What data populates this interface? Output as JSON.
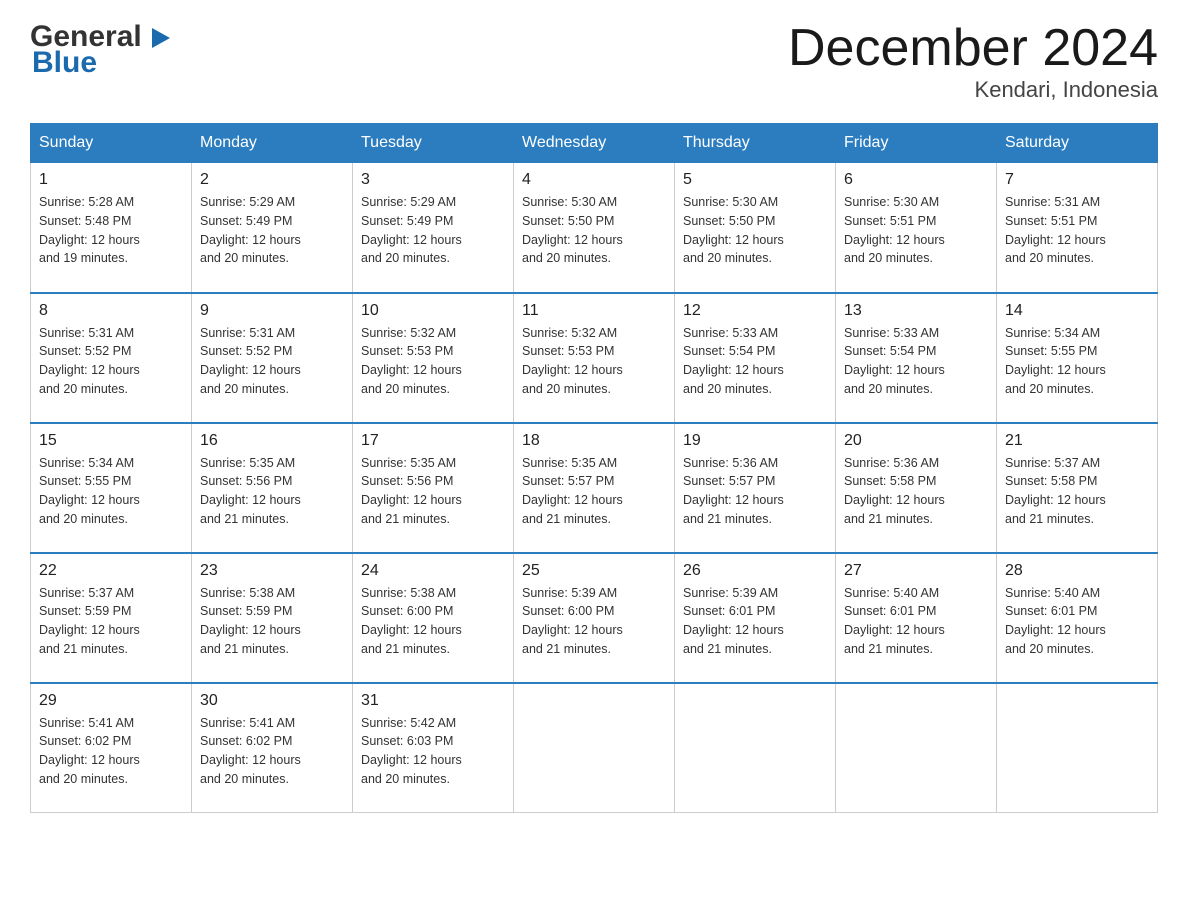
{
  "header": {
    "logo_general": "General",
    "logo_blue": "Blue",
    "month_title": "December 2024",
    "location": "Kendari, Indonesia"
  },
  "days_of_week": [
    "Sunday",
    "Monday",
    "Tuesday",
    "Wednesday",
    "Thursday",
    "Friday",
    "Saturday"
  ],
  "weeks": [
    [
      {
        "day": "1",
        "sunrise": "5:28 AM",
        "sunset": "5:48 PM",
        "daylight": "12 hours and 19 minutes."
      },
      {
        "day": "2",
        "sunrise": "5:29 AM",
        "sunset": "5:49 PM",
        "daylight": "12 hours and 20 minutes."
      },
      {
        "day": "3",
        "sunrise": "5:29 AM",
        "sunset": "5:49 PM",
        "daylight": "12 hours and 20 minutes."
      },
      {
        "day": "4",
        "sunrise": "5:30 AM",
        "sunset": "5:50 PM",
        "daylight": "12 hours and 20 minutes."
      },
      {
        "day": "5",
        "sunrise": "5:30 AM",
        "sunset": "5:50 PM",
        "daylight": "12 hours and 20 minutes."
      },
      {
        "day": "6",
        "sunrise": "5:30 AM",
        "sunset": "5:51 PM",
        "daylight": "12 hours and 20 minutes."
      },
      {
        "day": "7",
        "sunrise": "5:31 AM",
        "sunset": "5:51 PM",
        "daylight": "12 hours and 20 minutes."
      }
    ],
    [
      {
        "day": "8",
        "sunrise": "5:31 AM",
        "sunset": "5:52 PM",
        "daylight": "12 hours and 20 minutes."
      },
      {
        "day": "9",
        "sunrise": "5:31 AM",
        "sunset": "5:52 PM",
        "daylight": "12 hours and 20 minutes."
      },
      {
        "day": "10",
        "sunrise": "5:32 AM",
        "sunset": "5:53 PM",
        "daylight": "12 hours and 20 minutes."
      },
      {
        "day": "11",
        "sunrise": "5:32 AM",
        "sunset": "5:53 PM",
        "daylight": "12 hours and 20 minutes."
      },
      {
        "day": "12",
        "sunrise": "5:33 AM",
        "sunset": "5:54 PM",
        "daylight": "12 hours and 20 minutes."
      },
      {
        "day": "13",
        "sunrise": "5:33 AM",
        "sunset": "5:54 PM",
        "daylight": "12 hours and 20 minutes."
      },
      {
        "day": "14",
        "sunrise": "5:34 AM",
        "sunset": "5:55 PM",
        "daylight": "12 hours and 20 minutes."
      }
    ],
    [
      {
        "day": "15",
        "sunrise": "5:34 AM",
        "sunset": "5:55 PM",
        "daylight": "12 hours and 20 minutes."
      },
      {
        "day": "16",
        "sunrise": "5:35 AM",
        "sunset": "5:56 PM",
        "daylight": "12 hours and 21 minutes."
      },
      {
        "day": "17",
        "sunrise": "5:35 AM",
        "sunset": "5:56 PM",
        "daylight": "12 hours and 21 minutes."
      },
      {
        "day": "18",
        "sunrise": "5:35 AM",
        "sunset": "5:57 PM",
        "daylight": "12 hours and 21 minutes."
      },
      {
        "day": "19",
        "sunrise": "5:36 AM",
        "sunset": "5:57 PM",
        "daylight": "12 hours and 21 minutes."
      },
      {
        "day": "20",
        "sunrise": "5:36 AM",
        "sunset": "5:58 PM",
        "daylight": "12 hours and 21 minutes."
      },
      {
        "day": "21",
        "sunrise": "5:37 AM",
        "sunset": "5:58 PM",
        "daylight": "12 hours and 21 minutes."
      }
    ],
    [
      {
        "day": "22",
        "sunrise": "5:37 AM",
        "sunset": "5:59 PM",
        "daylight": "12 hours and 21 minutes."
      },
      {
        "day": "23",
        "sunrise": "5:38 AM",
        "sunset": "5:59 PM",
        "daylight": "12 hours and 21 minutes."
      },
      {
        "day": "24",
        "sunrise": "5:38 AM",
        "sunset": "6:00 PM",
        "daylight": "12 hours and 21 minutes."
      },
      {
        "day": "25",
        "sunrise": "5:39 AM",
        "sunset": "6:00 PM",
        "daylight": "12 hours and 21 minutes."
      },
      {
        "day": "26",
        "sunrise": "5:39 AM",
        "sunset": "6:01 PM",
        "daylight": "12 hours and 21 minutes."
      },
      {
        "day": "27",
        "sunrise": "5:40 AM",
        "sunset": "6:01 PM",
        "daylight": "12 hours and 21 minutes."
      },
      {
        "day": "28",
        "sunrise": "5:40 AM",
        "sunset": "6:01 PM",
        "daylight": "12 hours and 20 minutes."
      }
    ],
    [
      {
        "day": "29",
        "sunrise": "5:41 AM",
        "sunset": "6:02 PM",
        "daylight": "12 hours and 20 minutes."
      },
      {
        "day": "30",
        "sunrise": "5:41 AM",
        "sunset": "6:02 PM",
        "daylight": "12 hours and 20 minutes."
      },
      {
        "day": "31",
        "sunrise": "5:42 AM",
        "sunset": "6:03 PM",
        "daylight": "12 hours and 20 minutes."
      },
      null,
      null,
      null,
      null
    ]
  ]
}
